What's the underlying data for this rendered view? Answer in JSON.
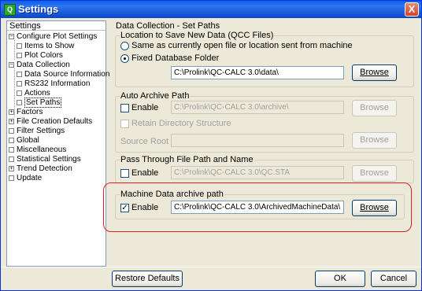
{
  "window": {
    "title": "Settings",
    "close_glyph": "X",
    "app_icon_glyph": "Q"
  },
  "tree": {
    "header": "Settings",
    "items": [
      {
        "label": "Configure Plot Settings",
        "expand": "−"
      },
      {
        "label": "Items to Show"
      },
      {
        "label": "Plot Colors"
      },
      {
        "label": "Data Collection",
        "expand": "−"
      },
      {
        "label": "Data Source Information"
      },
      {
        "label": "RS232 Information"
      },
      {
        "label": "Actions"
      },
      {
        "label": "Set Paths",
        "selected": true
      },
      {
        "label": "Factors",
        "expand": "+"
      },
      {
        "label": "File Creation Defaults",
        "expand": "+"
      },
      {
        "label": "Filter Settings"
      },
      {
        "label": "Global"
      },
      {
        "label": "Miscellaneous"
      },
      {
        "label": "Statistical Settings"
      },
      {
        "label": "Trend Detection",
        "expand": "+"
      },
      {
        "label": "Update"
      }
    ]
  },
  "panel": {
    "title": "Data Collection - Set Paths",
    "location": {
      "label": "Location to Save New Data (QCC Files)",
      "opt_same": "Same as currently open file or location sent from machine",
      "opt_fixed": "Fixed Database Folder",
      "path": "C:\\Prolink\\QC-CALC 3.0\\data\\",
      "browse": "Browse"
    },
    "auto_archive": {
      "label": "Auto Archive Path",
      "enable": "Enable",
      "path": "C:\\Prolink\\QC-CALC 3.0\\archive\\",
      "browse": "Browse",
      "retain": "Retain Directory Structure",
      "source_root": "Source Root",
      "source_browse": "Browse"
    },
    "pass_through": {
      "label": "Pass Through File Path and Name",
      "enable": "Enable",
      "path": "C:\\Prolink\\QC-CALC 3.0\\QC.STA",
      "browse": "Browse"
    },
    "machine_archive": {
      "label": "Machine Data archive path",
      "enable": "Enable",
      "checkmark": "✓",
      "path": "C:\\Prolink\\QC-CALC 3.0\\ArchivedMachineData\\",
      "browse": "Browse"
    }
  },
  "buttons": {
    "restore": "Restore Defaults",
    "ok": "OK",
    "cancel": "Cancel"
  }
}
